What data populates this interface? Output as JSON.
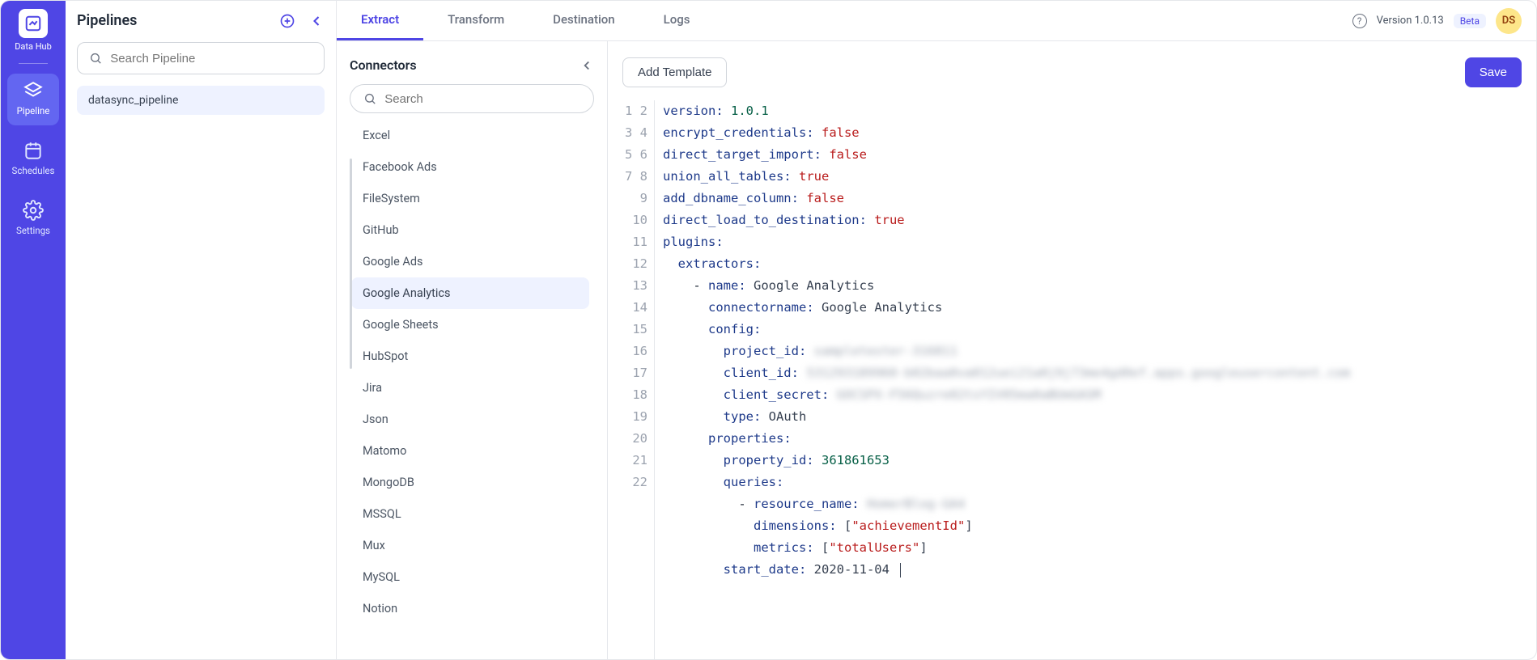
{
  "brand": {
    "name": "Data Hub"
  },
  "nav": {
    "items": [
      {
        "id": "pipeline",
        "label": "Pipeline",
        "active": true
      },
      {
        "id": "schedules",
        "label": "Schedules",
        "active": false
      },
      {
        "id": "settings",
        "label": "Settings",
        "active": false
      }
    ]
  },
  "pipelines": {
    "title": "Pipelines",
    "search_placeholder": "Search Pipeline",
    "items": [
      {
        "name": "datasync_pipeline",
        "active": true
      }
    ]
  },
  "tabs": [
    {
      "id": "extract",
      "label": "Extract",
      "active": true
    },
    {
      "id": "transform",
      "label": "Transform",
      "active": false
    },
    {
      "id": "destination",
      "label": "Destination",
      "active": false
    },
    {
      "id": "logs",
      "label": "Logs",
      "active": false
    }
  ],
  "header": {
    "version_label": "Version 1.0.13",
    "beta_badge": "Beta",
    "avatar_initials": "DS"
  },
  "connectors": {
    "title": "Connectors",
    "search_placeholder": "Search",
    "items": [
      {
        "label": "Excel",
        "active": false
      },
      {
        "label": "Facebook Ads",
        "active": false
      },
      {
        "label": "FileSystem",
        "active": false
      },
      {
        "label": "GitHub",
        "active": false
      },
      {
        "label": "Google Ads",
        "active": false
      },
      {
        "label": "Google Analytics",
        "active": true
      },
      {
        "label": "Google Sheets",
        "active": false
      },
      {
        "label": "HubSpot",
        "active": false
      },
      {
        "label": "Jira",
        "active": false
      },
      {
        "label": "Json",
        "active": false
      },
      {
        "label": "Matomo",
        "active": false
      },
      {
        "label": "MongoDB",
        "active": false
      },
      {
        "label": "MSSQL",
        "active": false
      },
      {
        "label": "Mux",
        "active": false
      },
      {
        "label": "MySQL",
        "active": false
      },
      {
        "label": "Notion",
        "active": false
      }
    ]
  },
  "editor": {
    "add_template_label": "Add Template",
    "save_label": "Save",
    "yaml": {
      "version": "1.0.1",
      "encrypt_credentials": "false",
      "direct_target_import": "false",
      "union_all_tables": "true",
      "add_dbname_column": "false",
      "direct_load_to_destination": "true",
      "plugins_key": "plugins:",
      "extractors_key": "extractors:",
      "name_key": "name:",
      "name_val": "Google Analytics",
      "connectorname_key": "connectorname:",
      "connectorname_val": "Google Analytics",
      "config_key": "config:",
      "project_id_key": "project_id:",
      "project_id_val": "sampletester-316811",
      "client_id_key": "client_id:",
      "client_id_val": "531293189960-b02baa0va012uei21a0j9j73me4gd0ef.apps.googleusercontent.com",
      "client_secret_key": "client_secret:",
      "client_secret_val": "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",
      "type_key": "type:",
      "type_val": "OAuth",
      "properties_key": "properties:",
      "property_id_key": "property_id:",
      "property_id_val": "361861653",
      "queries_key": "queries:",
      "resource_name_key": "resource_name:",
      "resource_name_val": "HomerBlog-GA4",
      "dimensions_key": "dimensions:",
      "dimensions_val": "[\"achievementId\"]",
      "metrics_key": "metrics:",
      "metrics_val": "[\"totalUsers\"]",
      "start_date_key": "start_date:",
      "start_date_val": "2020-11-04"
    },
    "line_count": 22
  }
}
